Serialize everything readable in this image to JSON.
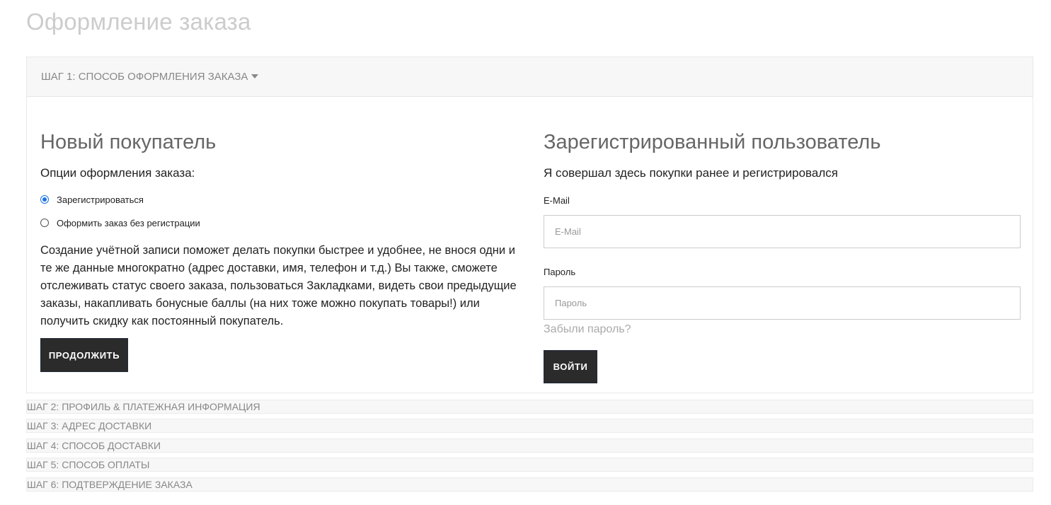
{
  "page": {
    "title": "Оформление заказа"
  },
  "step1": {
    "label": "ШАГ 1: СПОСОБ ОФОРМЛЕНИЯ ЗАКАЗА"
  },
  "new_customer": {
    "title": "Новый покупатель",
    "options_label": "Опции оформления заказа:",
    "option_register": "Зарегистрироваться",
    "option_guest": "Оформить заказ без регистрации",
    "selected": "register",
    "description": "Создание учётной записи поможет делать покупки быстрее и удобнее, не внося одни и те же данные многократно (адрес доставки, имя, телефон и т.д.) Вы также, сможете отслеживать статус своего заказа, пользоваться Закладками, видеть свои предыдущие заказы, накапливать бонусные баллы (на них тоже можно покупать товары!) или получить скидку как постоянный покупатель.",
    "continue_button": "ПРОДОЛЖИТЬ"
  },
  "registered": {
    "title": "Зарегистрированный пользователь",
    "subtitle": "Я совершал здесь покупки ранее и регистрировался",
    "email_label": "E-Mail",
    "email_placeholder": "E-Mail",
    "email_value": "",
    "password_label": "Пароль",
    "password_placeholder": "Пароль",
    "password_value": "",
    "forgot_link": "Забыли пароль?",
    "login_button": "ВОЙТИ"
  },
  "steps": [
    {
      "label": "ШАГ 2: ПРОФИЛЬ & ПЛАТЕЖНАЯ ИНФОРМАЦИЯ"
    },
    {
      "label": "ШАГ 3: АДРЕС ДОСТАВКИ"
    },
    {
      "label": "ШАГ 4: СПОСОБ ДОСТАВКИ"
    },
    {
      "label": "ШАГ 5: СПОСОБ ОПЛАТЫ"
    },
    {
      "label": "ШАГ 6: ПОДТВЕРЖДЕНИЕ ЗАКАЗА"
    }
  ],
  "colors": {
    "accent_radio": "#1a73e8",
    "button_bg": "#2b2b2b",
    "muted_text": "#888888"
  }
}
